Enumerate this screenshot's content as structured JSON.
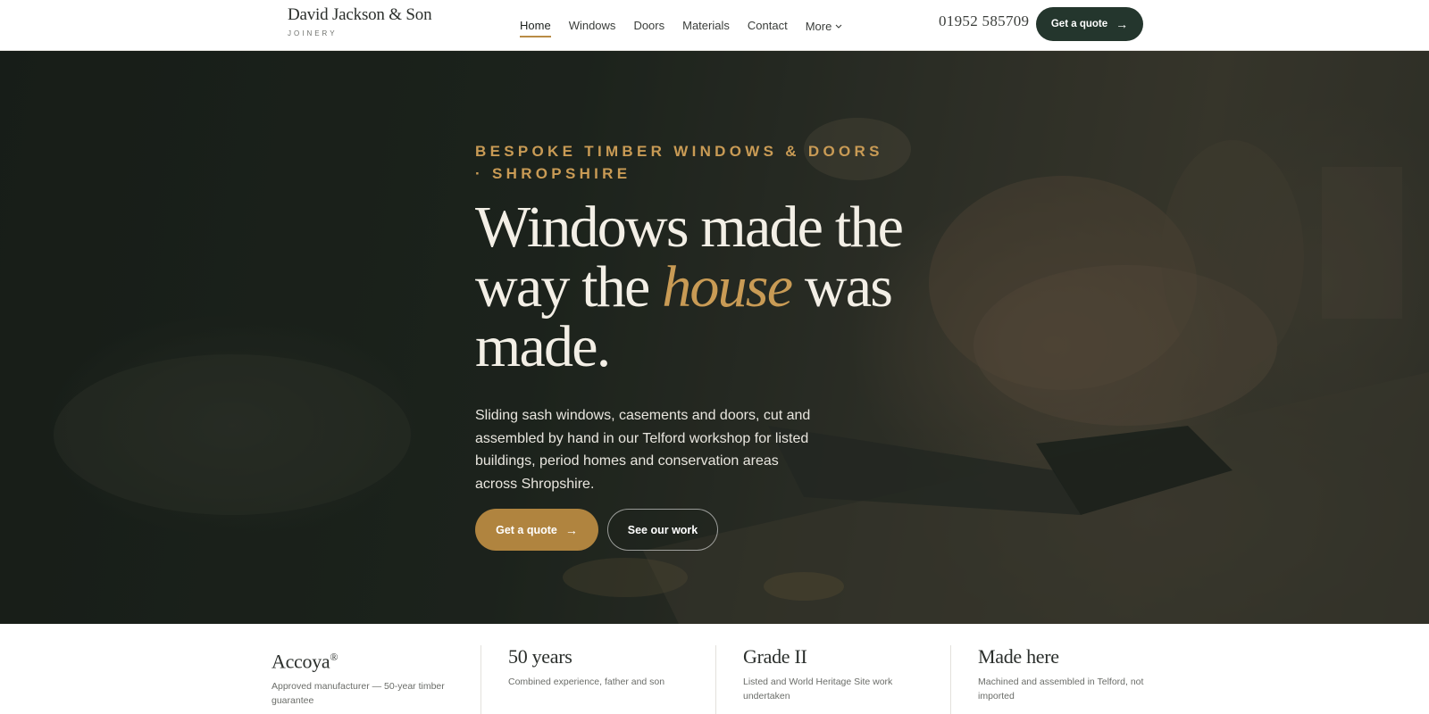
{
  "header": {
    "brand_name": "David Jackson & Son",
    "brand_sub": "JOINERY",
    "nav": [
      {
        "label": "Home",
        "active": true
      },
      {
        "label": "Windows"
      },
      {
        "label": "Doors"
      },
      {
        "label": "Materials"
      },
      {
        "label": "Contact"
      },
      {
        "label": "More"
      }
    ],
    "phone": "01952 585709",
    "cta_label": "Get a quote",
    "cta_arrow": "→"
  },
  "hero": {
    "eyebrow_line1": "BESPOKE TIMBER WINDOWS & DOORS",
    "eyebrow_line2": "· SHROPSHIRE",
    "headline_part1": "Windows made the",
    "headline_part2": "way the ",
    "headline_emphasis": "house",
    "headline_part3": " was",
    "headline_part4": "made.",
    "lead": "Sliding sash windows, casements and doors, cut and assembled by hand in our Telford workshop for listed buildings, period homes and conservation areas across Shropshire.",
    "primary_label": "Get a quote",
    "primary_arrow": "→",
    "secondary_label": "See our work"
  },
  "features": [
    {
      "title": "Accoya",
      "mark": "®",
      "text": "Approved manufacturer — 50-year timber guarantee"
    },
    {
      "title": "50 years",
      "text": "Combined experience, father and son"
    },
    {
      "title": "Grade II",
      "text": "Listed and World Heritage Site work undertaken"
    },
    {
      "title": "Made here",
      "text": "Machined and assembled in Telford, not imported"
    }
  ],
  "colors": {
    "accent_gold": "#c99b55",
    "button_gold": "#b0843f",
    "dark_green": "#24362d"
  }
}
